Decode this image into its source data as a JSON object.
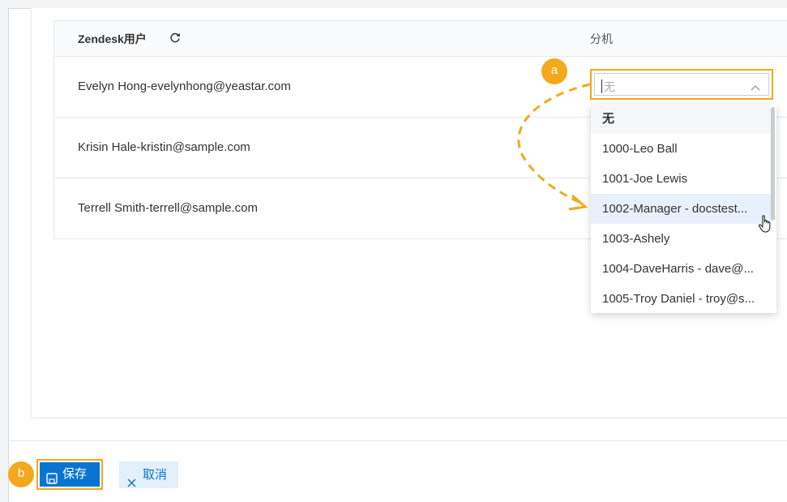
{
  "table": {
    "header_user": "Zendesk用户",
    "header_extension": "分机",
    "rows": [
      {
        "user": "Evelyn Hong-evelynhong@yeastar.com"
      },
      {
        "user": "Krisin Hale-kristin@sample.com"
      },
      {
        "user": "Terrell Smith-terrell@sample.com"
      }
    ]
  },
  "select": {
    "value": "无"
  },
  "dropdown": {
    "options": [
      "无",
      "1000-Leo Ball",
      "1001-Joe Lewis",
      "1002-Manager - docstest...",
      "1003-Ashely",
      "1004-DaveHarris - dave@...",
      "1005-Troy Daniel - troy@s..."
    ],
    "hovered_index": 3
  },
  "annotations": {
    "badge_a": "a",
    "badge_b": "b"
  },
  "footer": {
    "save_label": "保存",
    "cancel_label": "取消"
  },
  "colors": {
    "accent": "#f3a91b",
    "primary": "#0a74d1",
    "cancel_bg": "#e3f0fb"
  }
}
